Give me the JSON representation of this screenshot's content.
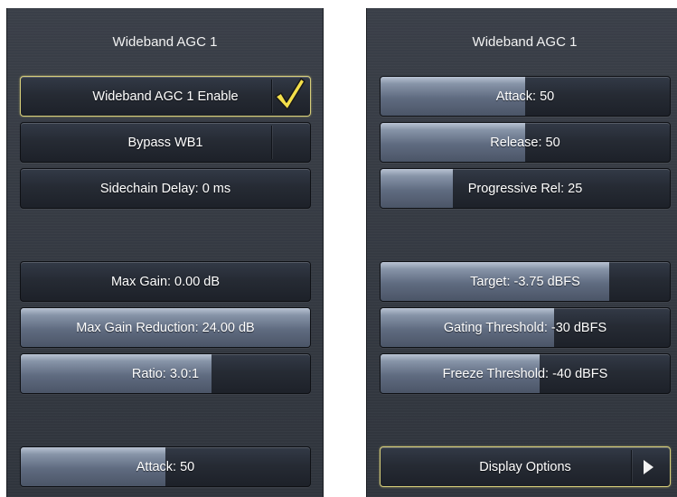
{
  "left_panel": {
    "title": "Wideband AGC 1",
    "buttons": [
      {
        "label": "Wideband AGC 1 Enable"
      },
      {
        "label": "Bypass WB1"
      },
      {
        "label": "Sidechain Delay: 0 ms"
      },
      {
        "label": "Max Gain: 0.00 dB"
      },
      {
        "label": "Max Gain Reduction: 24.00 dB"
      },
      {
        "label": "Ratio: 3.0:1"
      },
      {
        "label": "Attack: 50"
      }
    ],
    "enable_state": "checked",
    "check_icon": "checkmark-icon"
  },
  "right_panel": {
    "title": "Wideband AGC 1",
    "buttons": [
      {
        "label": "Attack: 50"
      },
      {
        "label": "Release: 50"
      },
      {
        "label": "Progressive Rel: 25"
      },
      {
        "label": "Target: -3.75 dBFS"
      },
      {
        "label": "Gating Threshold: -30 dBFS"
      },
      {
        "label": "Freeze Threshold: -40 dBFS"
      },
      {
        "label": "Display Options"
      }
    ],
    "display_options_icon": "arrow-right-icon"
  },
  "slider_levels": {
    "max_gain_reduction": 1.0,
    "ratio": 0.66,
    "attack": 0.5,
    "release": 0.5,
    "progressive_rel": 0.25,
    "target": 0.79,
    "gating_threshold": 0.6,
    "freeze_threshold": 0.55
  },
  "colors": {
    "highlight_border": "#d8cf7a",
    "check_fill": "#f4e04a"
  }
}
